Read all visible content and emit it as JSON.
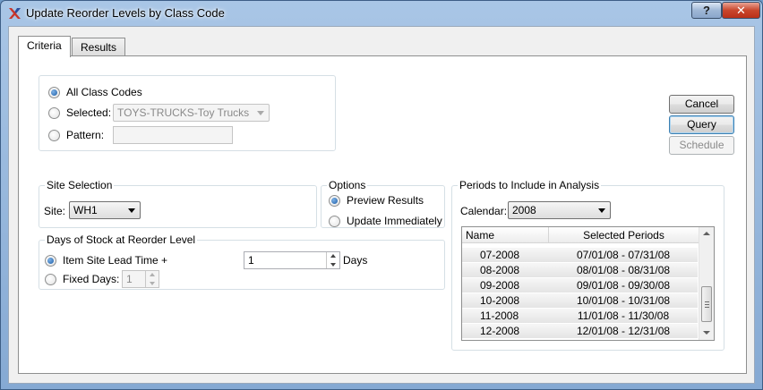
{
  "window": {
    "title": "Update Reorder Levels by Class Code",
    "help_label": "?",
    "close_label": "✕"
  },
  "tabs": [
    {
      "label": "Criteria",
      "active": true
    },
    {
      "label": "Results",
      "active": false
    }
  ],
  "class_codes": {
    "all_label": "All Class Codes",
    "selected_label": "Selected:",
    "selected_value": "TOYS-TRUCKS-Toy Trucks",
    "pattern_label": "Pattern:",
    "pattern_value": "",
    "selection": "all"
  },
  "buttons": {
    "cancel": "Cancel",
    "query": "Query",
    "schedule": "Schedule"
  },
  "site_selection": {
    "title": "Site Selection",
    "site_label": "Site:",
    "site_value": "WH1"
  },
  "options": {
    "title": "Options",
    "preview_label": "Preview Results",
    "update_label": "Update Immediately",
    "selection": "preview"
  },
  "days_of_stock": {
    "title": "Days of Stock at Reorder Level",
    "lead_time_label": "Item Site Lead Time +",
    "lead_time_value": "1",
    "days_label": "Days",
    "fixed_label": "Fixed Days:",
    "fixed_value": "1",
    "selection": "lead_time"
  },
  "periods": {
    "title": "Periods to Include in Analysis",
    "calendar_label": "Calendar:",
    "calendar_value": "2008",
    "columns": [
      "Name",
      "Selected Periods"
    ],
    "rows": [
      {
        "name": "07-2008",
        "range": "07/01/08 - 07/31/08"
      },
      {
        "name": "08-2008",
        "range": "08/01/08 - 08/31/08"
      },
      {
        "name": "09-2008",
        "range": "09/01/08 - 09/30/08"
      },
      {
        "name": "10-2008",
        "range": "10/01/08 - 10/31/08"
      },
      {
        "name": "11-2008",
        "range": "11/01/08 - 11/30/08"
      },
      {
        "name": "12-2008",
        "range": "12/01/08 - 12/31/08"
      }
    ]
  }
}
